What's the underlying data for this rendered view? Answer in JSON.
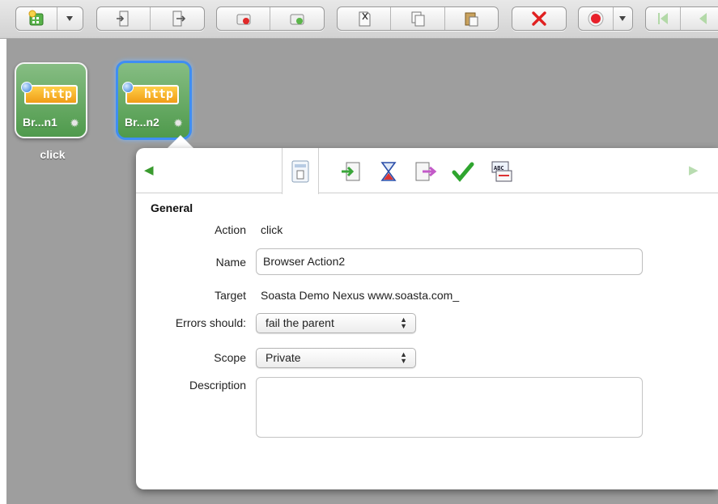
{
  "toolbar": {
    "icons": [
      "add-node-icon",
      "dropdown-arrow-icon",
      "import-icon",
      "export-icon",
      "disconnect-icon",
      "connect-icon",
      "cut-icon",
      "copy-icon",
      "paste-icon",
      "delete-icon",
      "record-icon",
      "record-dropdown-icon",
      "skip-to-start-icon",
      "step-back-icon"
    ]
  },
  "canvas": {
    "nodes": [
      {
        "protocol": "http",
        "name": "Br...n1",
        "caption": "click",
        "selected": false
      },
      {
        "protocol": "http",
        "name": "Br...n2",
        "caption": "",
        "selected": true
      }
    ],
    "background": "#9e9e9e"
  },
  "panel": {
    "tabs": [
      "general-tab-icon",
      "inputs-tab-icon",
      "timing-tab-icon",
      "outputs-tab-icon",
      "validations-tab-icon",
      "property-sets-tab-icon"
    ],
    "section_title": "General",
    "action_label": "Action",
    "action_value": "click",
    "name_label": "Name",
    "name_value": "Browser Action2",
    "target_label": "Target",
    "target_value": "Soasta Demo Nexus www.soasta.com_",
    "errors_label": "Errors should:",
    "errors_value": "fail the parent",
    "scope_label": "Scope",
    "scope_value": "Private",
    "description_label": "Description",
    "description_value": ""
  },
  "colors": {
    "node_green": "#5ea55b",
    "selection_blue": "#3f8ef2",
    "http_orange": "#f5a623",
    "delete_red": "#e02020",
    "record_red": "#e8202a"
  }
}
